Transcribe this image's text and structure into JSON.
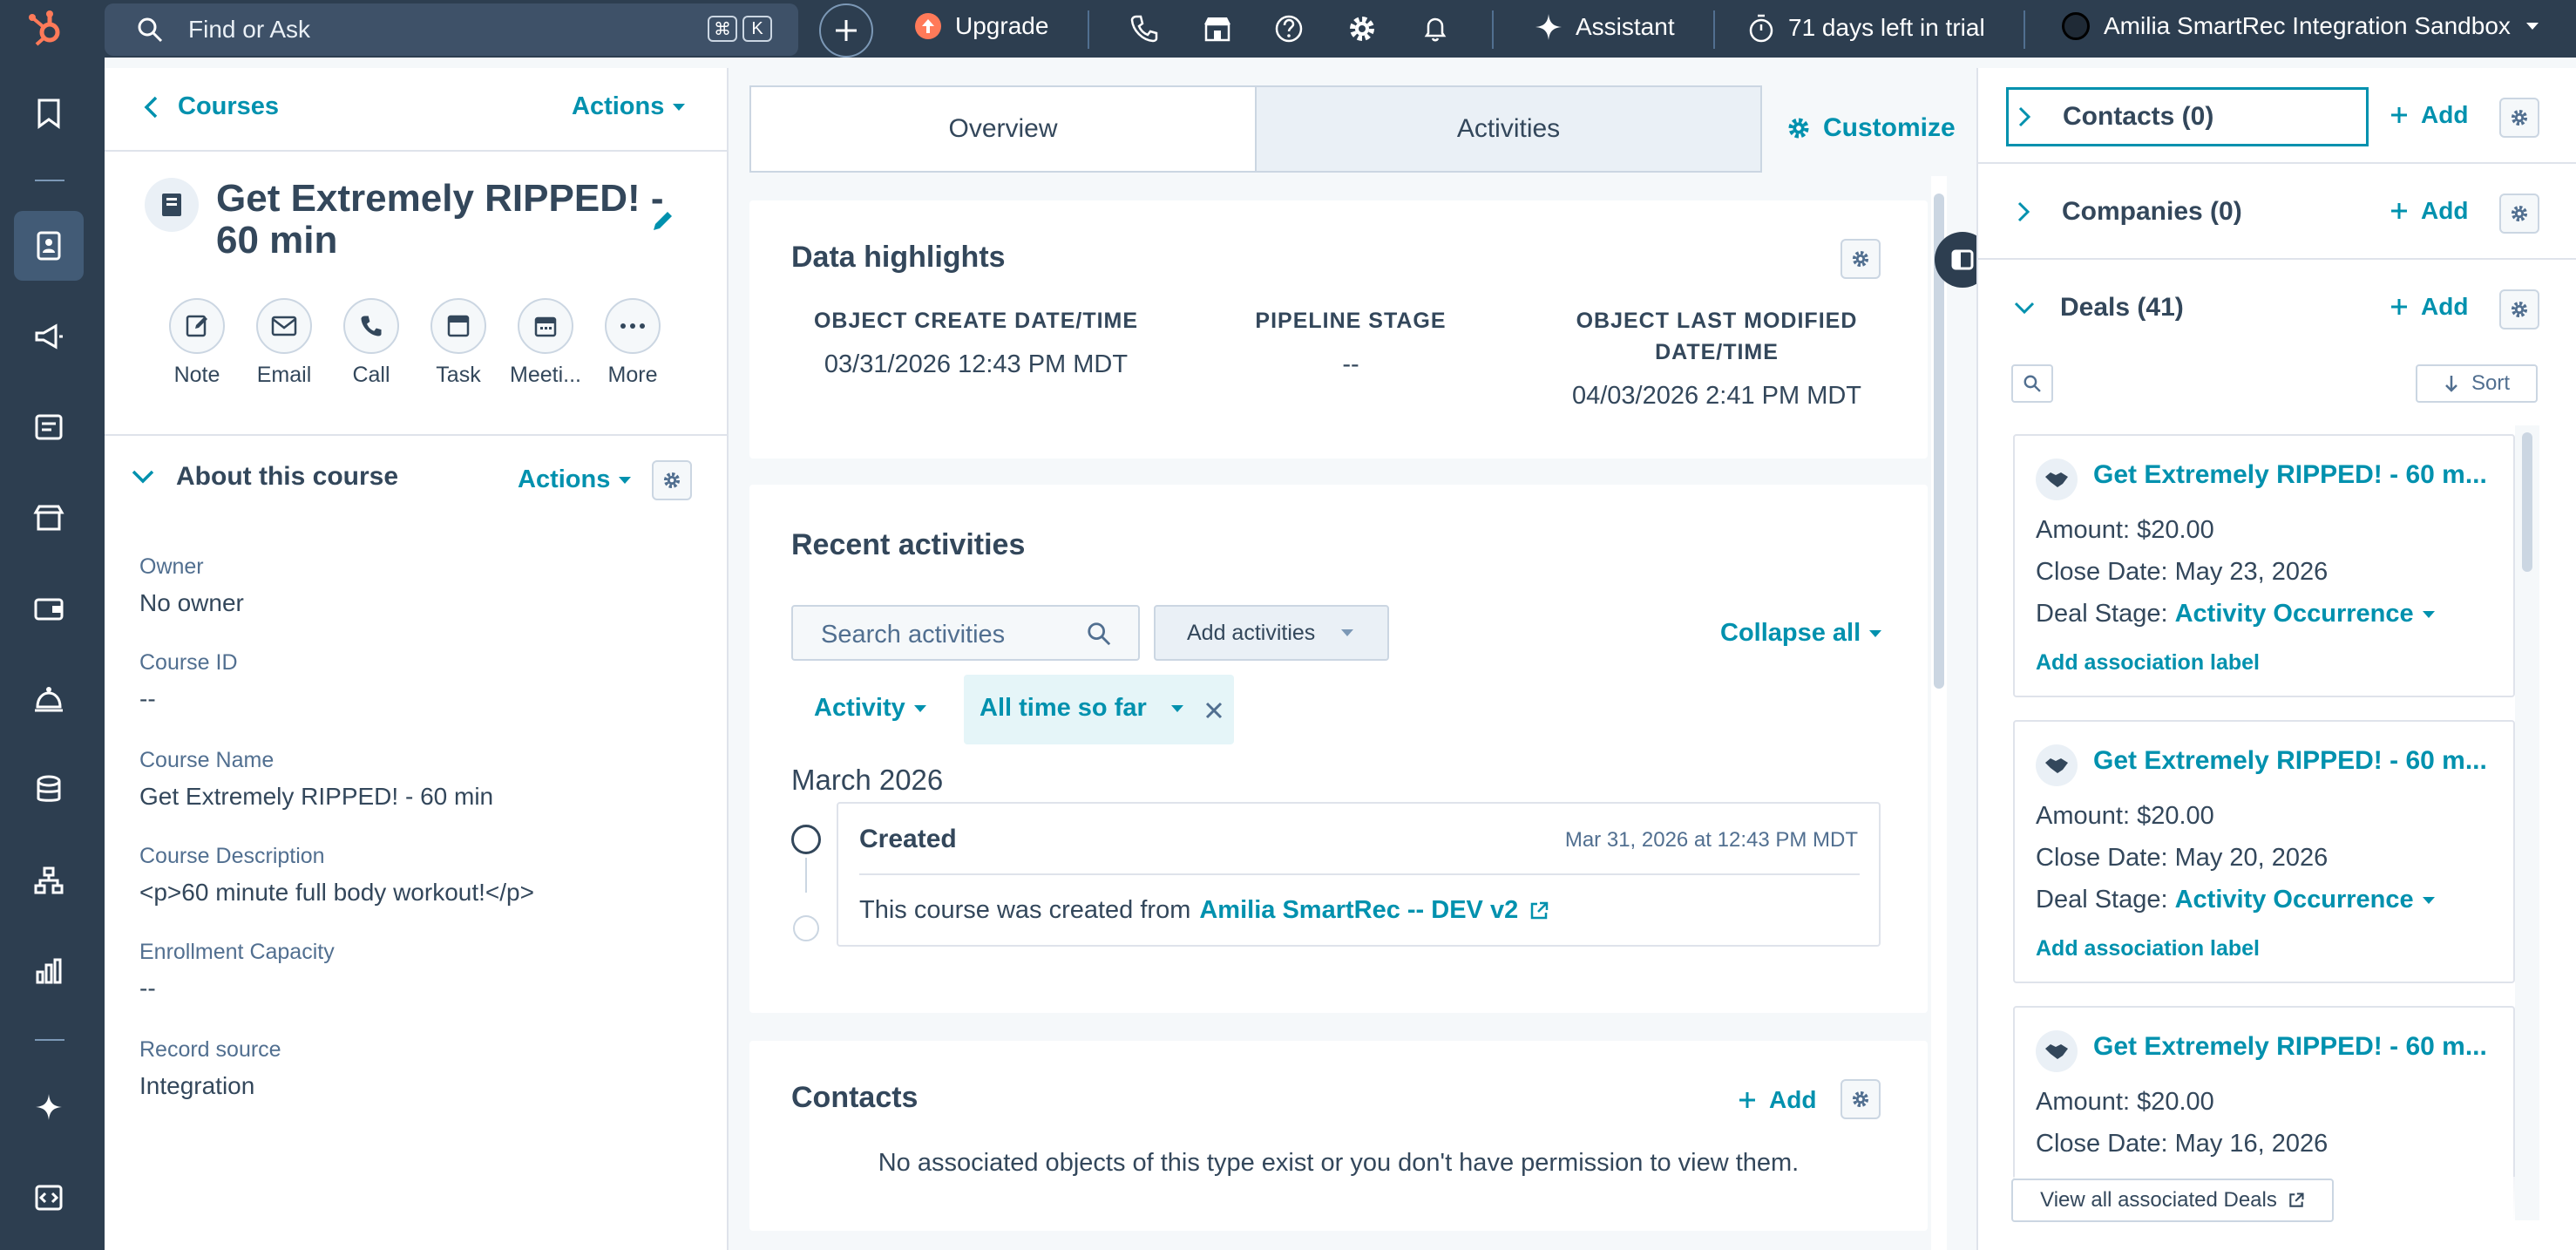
{
  "topbar": {
    "search_placeholder": "Find or Ask",
    "shortcut_cmd": "⌘",
    "shortcut_key": "K",
    "upgrade": "Upgrade",
    "assistant": "Assistant",
    "trial": "71 days left in trial",
    "account": "Amilia SmartRec Integration Sandbox"
  },
  "left": {
    "back": "Courses",
    "actions": "Actions",
    "title_line1": "Get Extremely RIPPED! -",
    "title_line2": "60 min",
    "quick_actions": [
      "Note",
      "Email",
      "Call",
      "Task",
      "Meeti...",
      "More"
    ],
    "about_title": "About this course",
    "about_actions": "Actions",
    "props": [
      {
        "label": "Owner",
        "value": "No owner"
      },
      {
        "label": "Course ID",
        "value": "--"
      },
      {
        "label": "Course Name",
        "value": "Get Extremely RIPPED! - 60 min"
      },
      {
        "label": "Course Description",
        "value": "<p>60 minute full body workout!</p>"
      },
      {
        "label": "Enrollment Capacity",
        "value": "--"
      },
      {
        "label": "Record source",
        "value": "Integration"
      }
    ]
  },
  "middle": {
    "tabs": [
      "Overview",
      "Activities"
    ],
    "customize": "Customize",
    "highlights": {
      "title": "Data highlights",
      "create_label": "OBJECT CREATE DATE/TIME",
      "create_value": "03/31/2026 12:43 PM MDT",
      "stage_label": "PIPELINE STAGE",
      "stage_value": "--",
      "modified_label_1": "OBJECT LAST MODIFIED",
      "modified_label_2": "DATE/TIME",
      "modified_value": "04/03/2026 2:41 PM MDT"
    },
    "recent": {
      "title": "Recent activities",
      "search_placeholder": "Search activities",
      "add_activities": "Add activities",
      "collapse_all": "Collapse all",
      "filter_activity": "Activity",
      "filter_time": "All time so far",
      "month": "March 2026",
      "item_title": "Created",
      "item_date": "Mar 31, 2026 at 12:43 PM MDT",
      "item_text": "This course was created from",
      "item_link": "Amilia SmartRec -- DEV v2"
    },
    "contacts": {
      "title": "Contacts",
      "add": "Add",
      "empty": "No associated objects of this type exist or you don't have permission to view them."
    }
  },
  "right": {
    "contacts": "Contacts (0)",
    "companies": "Companies (0)",
    "deals": "Deals (41)",
    "add": "Add",
    "sort": "Sort",
    "deal_cards": [
      {
        "title": "Get Extremely RIPPED! - 60 m...",
        "amount_label": "Amount:",
        "amount": "$20.00",
        "close_label": "Close Date:",
        "close": "May 23, 2026",
        "stage_label": "Deal Stage:",
        "stage": "Activity Occurrence",
        "assoc": "Add association label"
      },
      {
        "title": "Get Extremely RIPPED! - 60 m...",
        "amount_label": "Amount:",
        "amount": "$20.00",
        "close_label": "Close Date:",
        "close": "May 20, 2026",
        "stage_label": "Deal Stage:",
        "stage": "Activity Occurrence",
        "assoc": "Add association label"
      },
      {
        "title": "Get Extremely RIPPED! - 60 m...",
        "amount_label": "Amount:",
        "amount": "$20.00",
        "close_label": "Close Date:",
        "close": "May 16, 2026"
      }
    ],
    "view_all": "View all associated Deals"
  },
  "colors": {
    "nav": "#2d3e50",
    "link": "#0091ae",
    "text": "#33475b",
    "upgrade_badge": "#ff7a59"
  }
}
